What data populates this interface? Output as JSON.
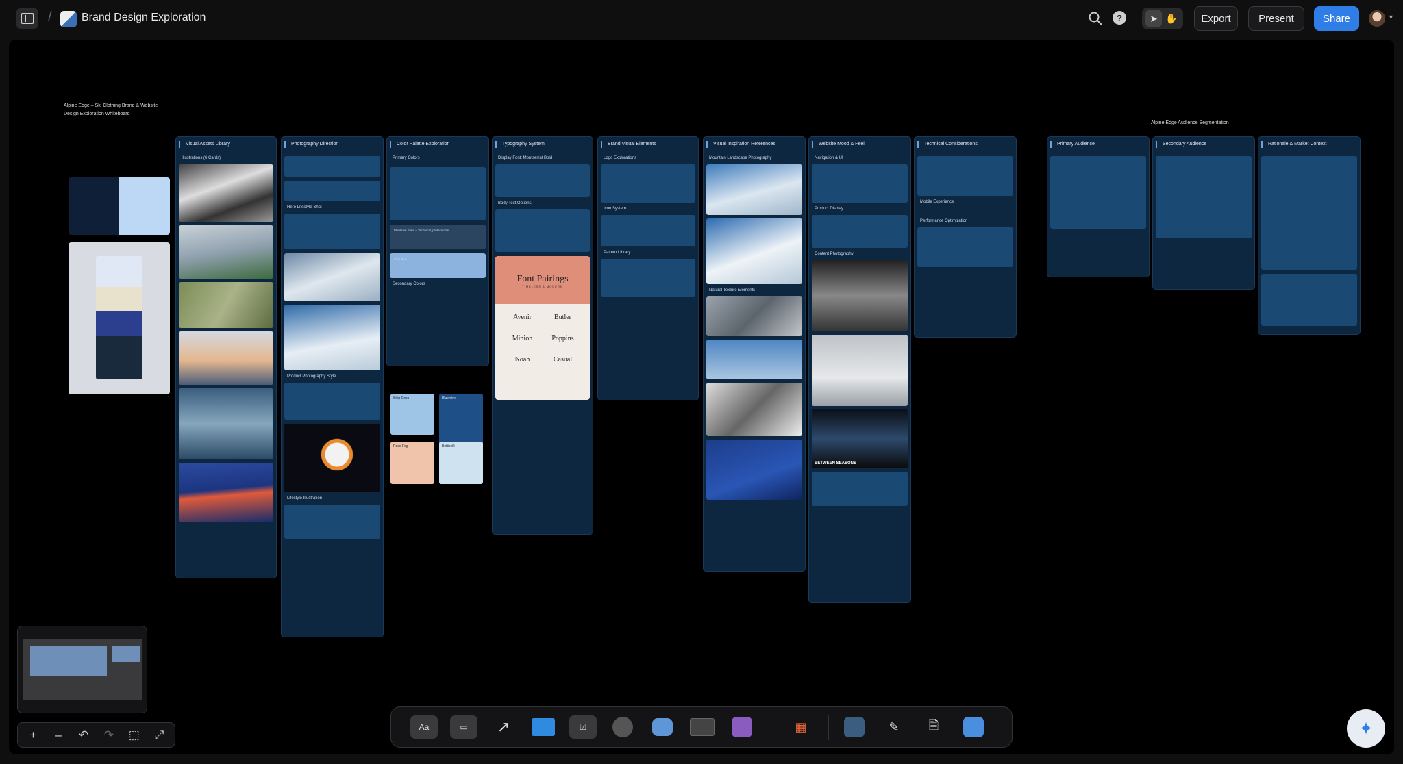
{
  "header": {
    "doc_title": "Brand Design Exploration",
    "separator": "/",
    "export_label": "Export",
    "present_label": "Present",
    "share_label": "Share",
    "help_label": "?"
  },
  "board": {
    "title": "Alpine Edge – Ski Clothing Brand & Website Design Exploration Whiteboard",
    "audience_title": "Alpine Edge Audience Segmentation",
    "columns": [
      {
        "title": "Visual Assets Library",
        "sub": "Illustrations (6 Cards)"
      },
      {
        "title": "Photography Direction",
        "sub1": "Hero Lifestyle Shot",
        "sub2": "Product Photography Style",
        "sub3": "Lifestyle Illustration"
      },
      {
        "title": "Color Palette Exploration",
        "sub1": "Primary Colors",
        "sub2": "Secondary Colors"
      },
      {
        "title": "Typography System",
        "sub1": "Display Font: Montserrat Bold",
        "sub2": "Body Text Options"
      },
      {
        "title": "Brand Visual Elements",
        "sub1": "Logo Explorations",
        "sub2": "Icon System",
        "sub3": "Pattern Library"
      },
      {
        "title": "Visual Inspiration References",
        "sub1": "Mountain Landscape Photography",
        "sub2": "Natural Texture Elements"
      },
      {
        "title": "Website Mood & Feel",
        "sub1": "Navigation & UI",
        "sub2": "Product Display",
        "sub3": "Content Photography"
      },
      {
        "title": "Technical Considerations",
        "sub1": "Mobile Experience",
        "sub2": "Performance Optimization"
      },
      {
        "title": "Primary Audience"
      },
      {
        "title": "Secondary Audience"
      },
      {
        "title": "Rationale & Market Context"
      }
    ],
    "swatches": [
      {
        "name": "Strip Coco"
      },
      {
        "name": "Bluemine"
      },
      {
        "name": "Rose Fog"
      },
      {
        "name": "Botticelli"
      }
    ],
    "palette_cards": [
      {
        "label": "Mountain Slate – Technical, professional..."
      },
      {
        "label": "Polo Blue"
      }
    ],
    "font_pairings": {
      "title": "Font Pairings",
      "subtitle": "TIMELESS & MODERN",
      "pairs": [
        "Avenir",
        "Butler",
        "Minion",
        "Poppins",
        "Noah",
        "Casual"
      ]
    },
    "content_label": "BETWEEN SEASONS"
  },
  "colors": {
    "accent": "#2f7de6",
    "column_bg": "#0d2741",
    "card_bg": "#1a4a73",
    "swatch_strip_coco": "#9ec4e6",
    "swatch_bluemine": "#1e4f86",
    "swatch_rose_fog": "#efc4aa",
    "swatch_botticelli": "#cfe2f0",
    "font_card_header": "#df8e79"
  },
  "icons": [
    "sidebar-toggle-icon",
    "search-icon",
    "help-icon",
    "pointer-icon",
    "hand-icon",
    "zoom-in-icon",
    "zoom-out-icon",
    "undo-icon",
    "redo-icon",
    "crop-icon",
    "fullscreen-icon",
    "sparkle-icon"
  ],
  "toolbar": {
    "text_tool_label": "Aa"
  },
  "zoom": {
    "in_label": "+",
    "out_label": "–"
  }
}
